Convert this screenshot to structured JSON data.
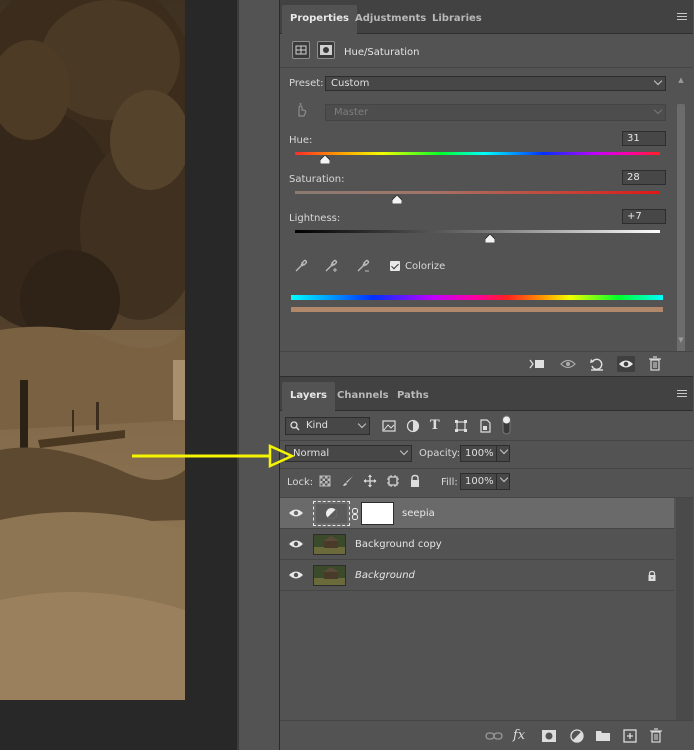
{
  "properties_panel": {
    "tabs": [
      {
        "label": "Properties"
      },
      {
        "label": "Adjustments"
      },
      {
        "label": "Libraries"
      }
    ],
    "adjustment_title": "Hue/Saturation",
    "preset": {
      "label": "Preset:",
      "value": "Custom"
    },
    "channel": {
      "value": "Master"
    },
    "hue": {
      "label": "Hue:",
      "value": "31"
    },
    "saturation": {
      "label": "Saturation:",
      "value": "28"
    },
    "lightness": {
      "label": "Lightness:",
      "value": "+7"
    },
    "colorize": {
      "label": "Colorize",
      "checked": true
    },
    "colors": {
      "sepia_bar": "#b1896a",
      "accent_yellow": "#f5f500"
    }
  },
  "layers_panel": {
    "tabs": [
      {
        "label": "Layers"
      },
      {
        "label": "Channels"
      },
      {
        "label": "Paths"
      }
    ],
    "filter": {
      "value": "Kind"
    },
    "blend_mode": {
      "value": "Normal"
    },
    "opacity": {
      "label": "Opacity:",
      "value": "100%"
    },
    "lock": {
      "label": "Lock:"
    },
    "fill": {
      "label": "Fill:",
      "value": "100%"
    },
    "layers": [
      {
        "name": "seepia",
        "type": "adjustment",
        "selected": true,
        "visible": true
      },
      {
        "name": "Background copy",
        "type": "image",
        "selected": false,
        "visible": true
      },
      {
        "name": "Background",
        "type": "image",
        "selected": false,
        "visible": true,
        "locked": true
      }
    ]
  }
}
